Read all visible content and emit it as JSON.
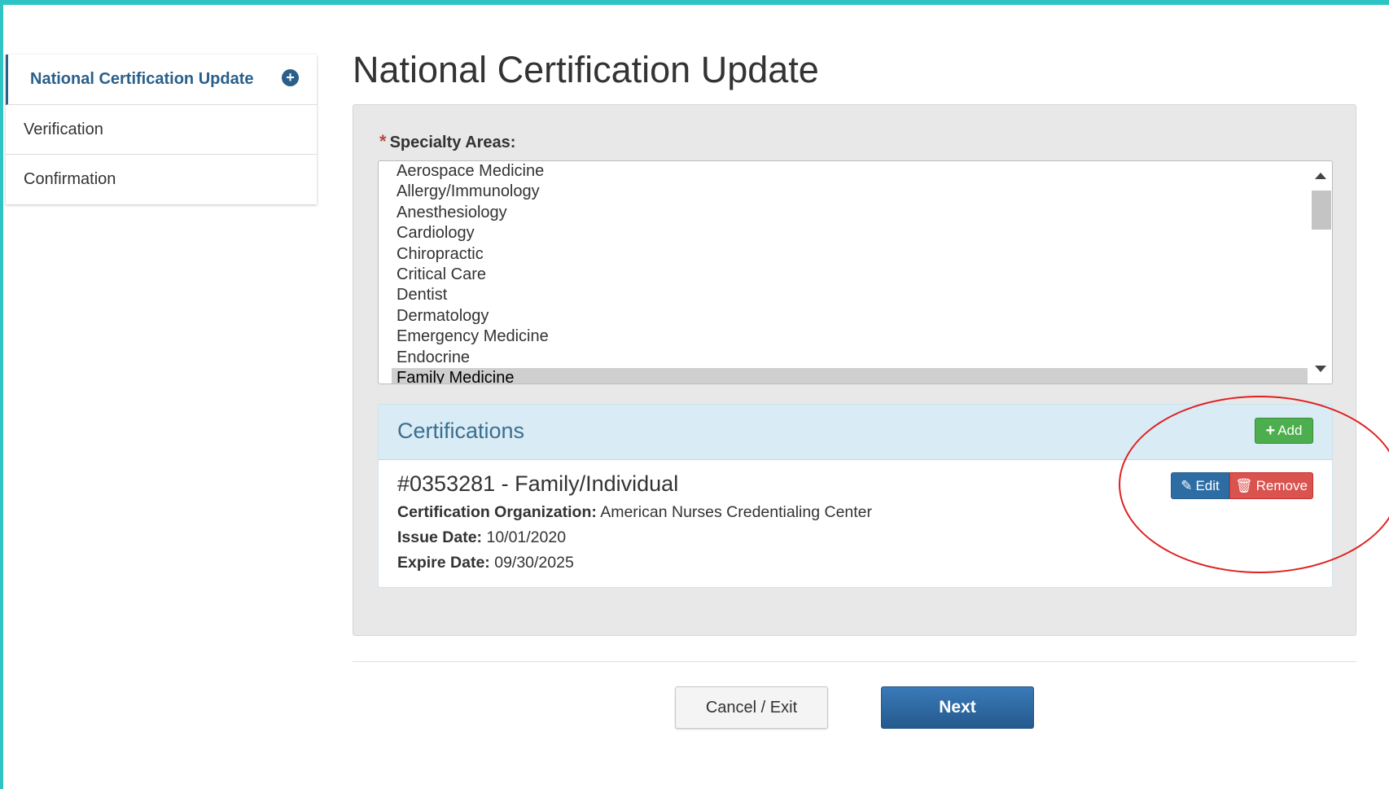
{
  "sidebar": {
    "items": [
      {
        "label": "National Certification Update",
        "active": true,
        "icon": "plus-circle-icon"
      },
      {
        "label": "Verification",
        "active": false
      },
      {
        "label": "Confirmation",
        "active": false
      }
    ]
  },
  "page": {
    "title": "National Certification Update"
  },
  "specialty": {
    "label": "Specialty Areas:",
    "required_marker": "*",
    "options": [
      "Aerospace Medicine",
      "Allergy/Immunology",
      "Anesthesiology",
      "Cardiology",
      "Chiropractic",
      "Critical Care",
      "Dentist",
      "Dermatology",
      "Emergency Medicine",
      "Endocrine",
      "Family Medicine"
    ],
    "selected": "Family Medicine"
  },
  "certifications": {
    "header": "Certifications",
    "add_label": "Add",
    "items": [
      {
        "title": "#0353281 - Family/Individual",
        "org_label": "Certification Organization:",
        "org_value": "American Nurses Credentialing Center",
        "issue_label": "Issue Date:",
        "issue_value": "10/01/2020",
        "expire_label": "Expire Date:",
        "expire_value": "09/30/2025",
        "edit_label": "Edit",
        "remove_label": "Remove"
      }
    ]
  },
  "footer": {
    "cancel_label": "Cancel / Exit",
    "next_label": "Next"
  },
  "colors": {
    "frame": "#2ec4c4",
    "primary": "#2a5f8a",
    "success": "#4cae4c",
    "danger": "#d9534f",
    "annotation": "#e02020"
  }
}
